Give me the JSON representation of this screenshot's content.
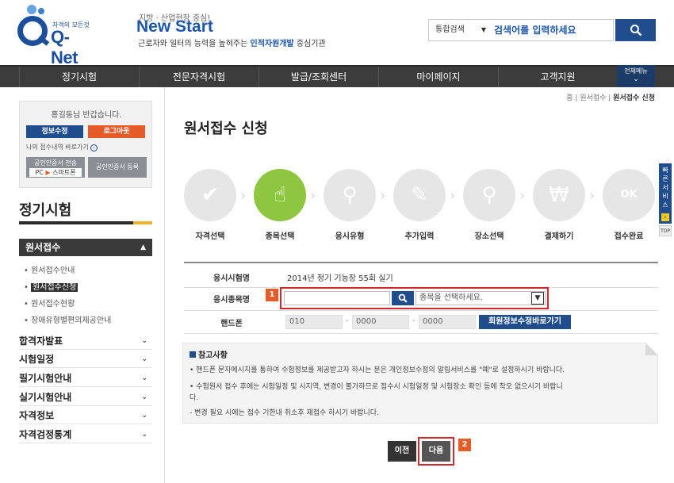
{
  "header": {
    "logo_tag": "자격의 모든것",
    "logo_text": "Q-Net",
    "slogan_small": "지방 · 산업현장 중심!",
    "slogan_big": "New Start",
    "slogan_sub_pre": "근로자와 일터의 능력을 높혀주는 ",
    "slogan_sub_em": "인적자원개발",
    "slogan_sub_post": " 중심기관",
    "search_scope": "통합검색",
    "search_placeholder": "검색어를 입력하세요",
    "search_icon": "search-icon"
  },
  "gnb": {
    "items": [
      "정기시험",
      "전문자격시험",
      "발급/조회센터",
      "마이페이지",
      "고객지원"
    ],
    "allmenu_label": "전체메뉴"
  },
  "sidebar": {
    "greeting": "홍길동님 반갑습니다.",
    "edit_info": "정보수정",
    "logout": "로그아웃",
    "my_apply": "나의 접수내역 바로가기",
    "cert_transfer_1": "공인인증서 전송",
    "cert_transfer_pc": "PC",
    "cert_transfer_phone": "스마트폰",
    "cert_register": "공인인증서 등록",
    "title": "정기시험",
    "active_menu": "원서접수",
    "sub_items": [
      "원서접수안내",
      "원서접수신청",
      "원서접수현황",
      "장애유형별편의제공안내"
    ],
    "menus": [
      "합격자발표",
      "시험일정",
      "필기시험안내",
      "실기시험안내",
      "자격정보",
      "자격검정통계"
    ]
  },
  "breadcrumb": {
    "home": "홈",
    "level1": "원서접수",
    "current": "원서접수 신청"
  },
  "page_title": "원서접수 신청",
  "steps": [
    {
      "label": "자격선택",
      "icon": "check-icon"
    },
    {
      "label": "종목선택",
      "icon": "hand-pointer-icon"
    },
    {
      "label": "응시유형",
      "icon": "magnifier-icon"
    },
    {
      "label": "추가입력",
      "icon": "pencil-icon"
    },
    {
      "label": "장소선택",
      "icon": "location-pin-icon"
    },
    {
      "label": "결제하기",
      "icon": "won-coin-icon"
    },
    {
      "label": "접수완료",
      "icon": "ok-monitor-icon"
    }
  ],
  "active_step": 1,
  "form": {
    "exam_name_label": "응시시험명",
    "exam_name_value": "2014년 정기 기능장 55회 실기",
    "subject_label": "응시종목명",
    "subject_badge": "1",
    "subject_input": "",
    "subject_select": "종목을 선택하세요.",
    "phone_label": "핸드폰",
    "phone_1": "010",
    "phone_2": "0000",
    "phone_3": "0000",
    "phone_sep": "-",
    "member_edit_button": "회원정보수정바로가기"
  },
  "notice": {
    "title": "참고사항",
    "line1": "• 핸드폰 문자메시지를 통하여 수험정보를 제공받고자 하시는 분은 개인정보수정의 알림서비스를 \"예\"로 설정하시기 바랍니다.",
    "line2": "• 수험원서 접수 후에는 시험일정 및 시지역, 변경이 불가하므로 접수시 시험일정 및 시험장소 확인 등에 착오 없으시기 바랍니",
    "line3": "  다.",
    "line4": "  - 변경 필요 시에는 접수 기한내 취소후 재접수 하시기 바랍니다."
  },
  "buttons": {
    "prev": "이전",
    "next": "다음",
    "next_badge": "2"
  },
  "quick": {
    "label": "빠른서비스",
    "top": "TOP"
  },
  "colors": {
    "brand": "#1f4d8e",
    "active_step": "#8dc63f",
    "highlight": "#d6262f",
    "badge": "#e55b2a"
  }
}
